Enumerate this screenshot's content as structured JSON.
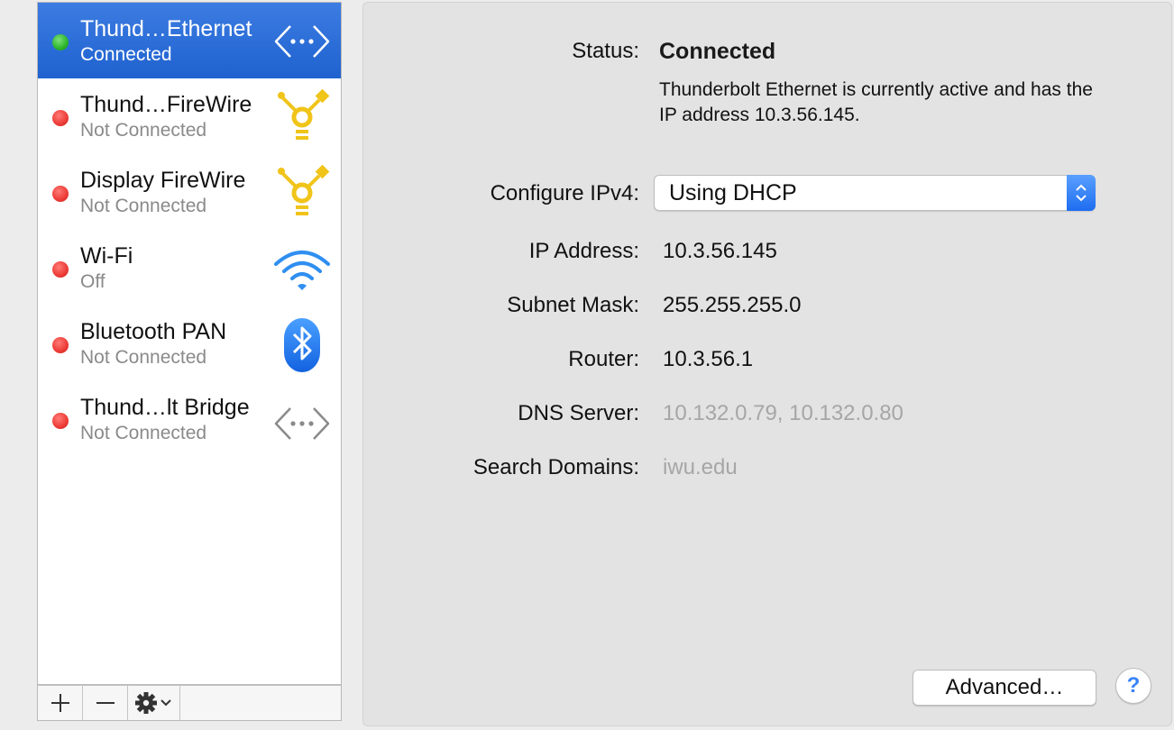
{
  "services": [
    {
      "name": "Thund…Ethernet",
      "status": "Connected",
      "state": "connected",
      "icon": "ethernet-icon",
      "selected": true
    },
    {
      "name": "Thund…FireWire",
      "status": "Not Connected",
      "state": "disconnected",
      "icon": "firewire-icon",
      "selected": false
    },
    {
      "name": "Display FireWire",
      "status": "Not Connected",
      "state": "disconnected",
      "icon": "firewire-icon",
      "selected": false
    },
    {
      "name": "Wi-Fi",
      "status": "Off",
      "state": "disconnected",
      "icon": "wifi-icon",
      "selected": false
    },
    {
      "name": "Bluetooth PAN",
      "status": "Not Connected",
      "state": "disconnected",
      "icon": "bluetooth-icon",
      "selected": false
    },
    {
      "name": "Thund…lt Bridge",
      "status": "Not Connected",
      "state": "disconnected",
      "icon": "bridge-icon",
      "selected": false
    }
  ],
  "toolbar": {
    "add_symbol": "+",
    "remove_symbol": "—",
    "add_icon": "plus-icon",
    "remove_icon": "minus-icon",
    "action_icon": "gear-icon"
  },
  "detail": {
    "status_label": "Status:",
    "status_value": "Connected",
    "status_description": "Thunderbolt Ethernet is currently active and has the IP address 10.3.56.145.",
    "configure_label": "Configure IPv4:",
    "configure_value": "Using DHCP",
    "ip_label": "IP Address:",
    "ip_value": "10.3.56.145",
    "subnet_label": "Subnet Mask:",
    "subnet_value": "255.255.255.0",
    "router_label": "Router:",
    "router_value": "10.3.56.1",
    "dns_label": "DNS Server:",
    "dns_value": "10.132.0.79, 10.132.0.80",
    "search_label": "Search Domains:",
    "search_value": "iwu.edu"
  },
  "buttons": {
    "advanced_label": "Advanced…",
    "help_label": "?"
  },
  "colors": {
    "selection": "#2c6bd4",
    "connected": "#2cb52b",
    "disconnected": "#ec3b36",
    "firewire": "#f0c419",
    "wifi": "#2f8ff0",
    "bluetooth": "#1e78f0"
  }
}
